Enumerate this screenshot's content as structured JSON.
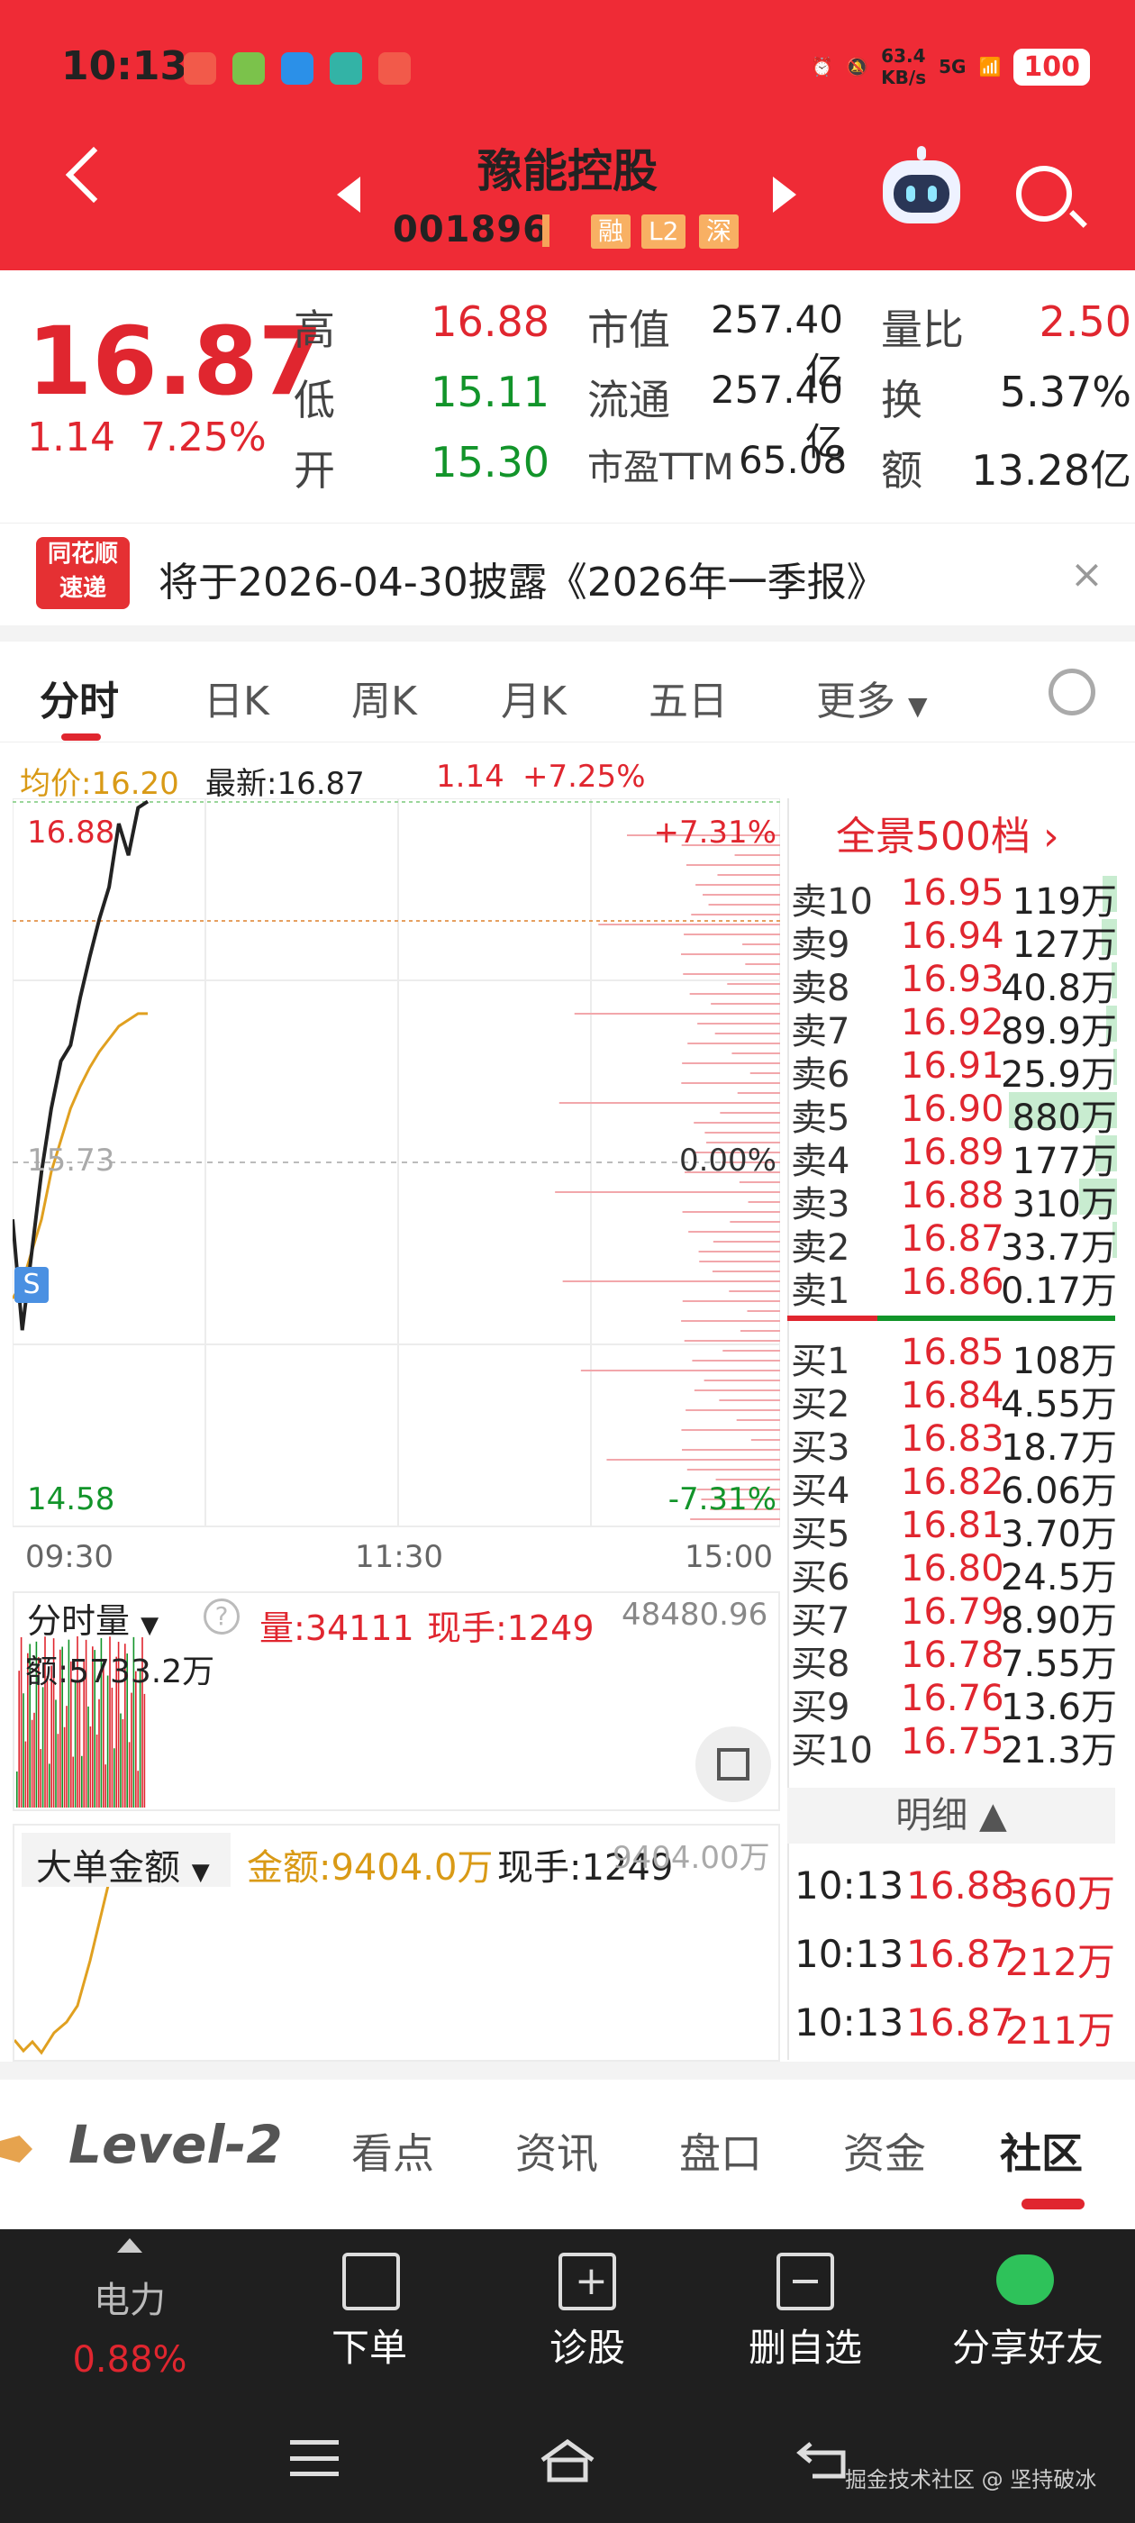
{
  "status": {
    "time": "10:13",
    "net_speed_value": "63.4",
    "net_speed_unit": "KB/s",
    "signal": "5G",
    "battery": "100"
  },
  "header": {
    "title": "豫能控股",
    "code": "001896",
    "badges": [
      "融",
      "L2",
      "深"
    ]
  },
  "quote": {
    "price": "16.87",
    "change": "1.14",
    "change_pct": "7.25%",
    "high_label": "高",
    "high": "16.88",
    "low_label": "低",
    "low": "15.11",
    "open_label": "开",
    "open": "15.30",
    "mcap_label": "市值",
    "mcap": "257.40亿",
    "float_label": "流通",
    "float": "257.40亿",
    "pe_label": "市盈TTM",
    "pe": "65.08",
    "vr_label": "量比",
    "vr": "2.50",
    "turn_label": "换",
    "turn": "5.37%",
    "amt_label": "额",
    "amt": "13.28亿"
  },
  "notice": {
    "logo_top": "同花顺",
    "logo_bottom": "速递",
    "text": "将于2026-04-30披露《2026年一季报》",
    "close": "×"
  },
  "tabs": [
    "分时",
    "日K",
    "周K",
    "月K",
    "五日",
    "更多"
  ],
  "info": {
    "avg": "均价:16.20",
    "latest": "最新:16.87",
    "chg": "1.14",
    "pct": "+7.25%"
  },
  "chart": {
    "y_top": "16.88",
    "y_mid": "15.73",
    "y_bot": "14.58",
    "pct_top": "+7.31%",
    "pct_mid": "0.00%",
    "pct_bot": "-7.31%",
    "times": [
      "09:30",
      "11:30",
      "15:00"
    ],
    "s_marker": "S",
    "colors": {
      "price": "#222222",
      "avg": "#e0a020",
      "up": "#e0262f",
      "down": "#12942a"
    }
  },
  "chart_data": {
    "type": "line",
    "series": [
      {
        "name": "最新",
        "values": [
          15.55,
          15.2,
          15.45,
          15.7,
          15.9,
          16.05,
          16.1,
          16.25,
          16.38,
          16.5,
          16.6,
          16.8,
          16.7,
          16.85,
          16.87
        ]
      },
      {
        "name": "均价",
        "values": [
          15.3,
          15.35,
          15.45,
          15.55,
          15.7,
          15.8,
          15.9,
          15.97,
          16.03,
          16.08,
          16.12,
          16.16,
          16.18,
          16.2,
          16.2
        ]
      }
    ],
    "ylim": [
      14.58,
      16.88
    ]
  },
  "volume": {
    "title": "分时量",
    "vol": "量:34111",
    "hand": "现手:1249",
    "max": "48480.96",
    "amt": "额:5733.2万"
  },
  "bigorder": {
    "title": "大单金额",
    "amt": "金额:9404.0万",
    "hand": "现手:1249",
    "max": "9404.00万"
  },
  "orderbook": {
    "title": "全景500档",
    "sell": [
      {
        "l": "卖10",
        "p": "16.95",
        "v": "119万",
        "w": 0.13
      },
      {
        "l": "卖9",
        "p": "16.94",
        "v": "127万",
        "w": 0.14
      },
      {
        "l": "卖8",
        "p": "16.93",
        "v": "40.8万",
        "w": 0.05
      },
      {
        "l": "卖7",
        "p": "16.92",
        "v": "89.9万",
        "w": 0.1
      },
      {
        "l": "卖6",
        "p": "16.91",
        "v": "25.9万",
        "w": 0.03
      },
      {
        "l": "卖5",
        "p": "16.90",
        "v": "880万",
        "w": 1.0
      },
      {
        "l": "卖4",
        "p": "16.89",
        "v": "177万",
        "w": 0.2
      },
      {
        "l": "卖3",
        "p": "16.88",
        "v": "310万",
        "w": 0.35
      },
      {
        "l": "卖2",
        "p": "16.87",
        "v": "33.7万",
        "w": 0.04
      },
      {
        "l": "卖1",
        "p": "16.86",
        "v": "0.17万",
        "w": 0.0
      }
    ],
    "buy": [
      {
        "l": "买1",
        "p": "16.85",
        "v": "108万"
      },
      {
        "l": "买2",
        "p": "16.84",
        "v": "4.55万"
      },
      {
        "l": "买3",
        "p": "16.83",
        "v": "18.7万"
      },
      {
        "l": "买4",
        "p": "16.82",
        "v": "6.06万"
      },
      {
        "l": "买5",
        "p": "16.81",
        "v": "3.70万"
      },
      {
        "l": "买6",
        "p": "16.80",
        "v": "24.5万"
      },
      {
        "l": "买7",
        "p": "16.79",
        "v": "8.90万"
      },
      {
        "l": "买8",
        "p": "16.78",
        "v": "7.55万"
      },
      {
        "l": "买9",
        "p": "16.76",
        "v": "13.6万"
      },
      {
        "l": "买10",
        "p": "16.75",
        "v": "21.3万"
      }
    ],
    "detail_title": "明细 ▲",
    "ticks": [
      {
        "t": "10:13",
        "p": "16.88",
        "v": "360万"
      },
      {
        "t": "10:13",
        "p": "16.87",
        "v": "212万"
      },
      {
        "t": "10:13",
        "p": "16.87",
        "v": "211万"
      }
    ]
  },
  "bottom_tabs": {
    "level2": "Level-2",
    "items": [
      "看点",
      "资讯",
      "盘口",
      "资金",
      "社区"
    ]
  },
  "action_bar": {
    "sector_name": "电力",
    "sector_pct": "0.88%",
    "order": "下单",
    "diagnose": "诊股",
    "remove": "删自选",
    "share": "分享好友"
  },
  "watermark": "掘金技术社区 @ 坚持破冰"
}
